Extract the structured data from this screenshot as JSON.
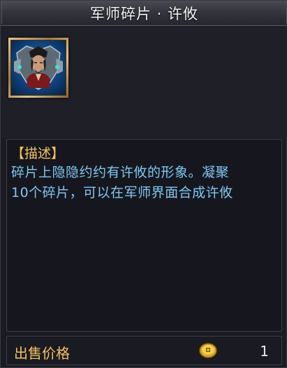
{
  "window": {
    "title": "军师碎片 · 许攸"
  },
  "item": {
    "icon": "strategist-portrait-icon",
    "frame_color": "#c9a464",
    "background_color": "#1a6fb8"
  },
  "description": {
    "heading": "【描述】",
    "line1": "碎片上隐隐约约有许攸的形象。凝聚",
    "line2": "10个碎片，可以在军师界面合成许攸"
  },
  "sell": {
    "label": "出售价格",
    "currency_icon": "gold-coin-icon",
    "price": "1"
  },
  "colors": {
    "heading": "#f4c45a",
    "body_text": "#7fc8f2",
    "title_text": "#f2f2f2"
  }
}
